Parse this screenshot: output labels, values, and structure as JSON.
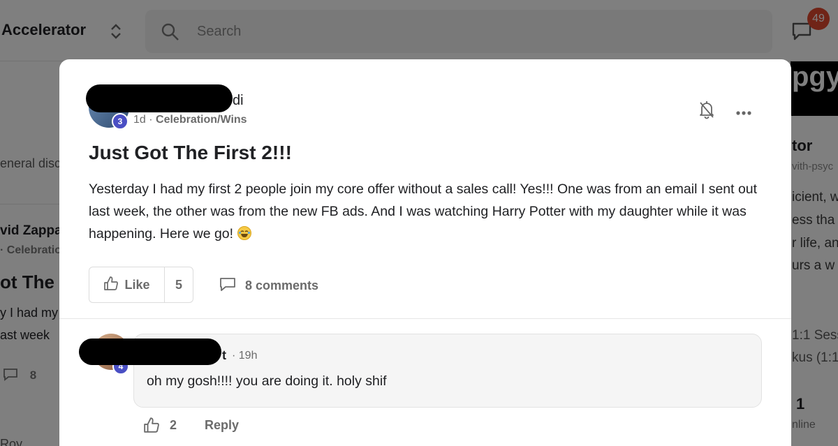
{
  "background": {
    "group_name": "Accelerator",
    "search_placeholder": "Search",
    "notification_count": "49",
    "logo_fragment": "pgy",
    "left_column": {
      "category_fragment": "eneral disc",
      "author_fragment": "vid Zappa",
      "meta_fragment": "· Celebratio",
      "title_fragment": "ot The F",
      "body_line1": "y I had my",
      "body_line2": "ast week",
      "comment_count_fragment": "8",
      "bottom_fragment": "Roy"
    },
    "right_column": {
      "title_fragment": "tor",
      "subtitle_fragment": "vith-psyc",
      "line1": "icient, w",
      "line2": "ess tha",
      "line3": "r life, an",
      "line4": "urs a w",
      "line5": "1:1 Sess",
      "line6": "kus (1:1",
      "online_count": "1",
      "online_label": "nline"
    }
  },
  "post": {
    "author_suffix": "di",
    "level": "3",
    "time_ago": "1d",
    "separator": "·",
    "category": "Celebration/Wins",
    "title": "Just Got The First 2!!!",
    "body": "Yesterday I had my first 2 people join my core offer without a sales call! Yes!!! One was from an email I sent out last week, the other was from the new FB ads. And I was watching Harry Potter with my daughter while it was happening. Here we go!",
    "emoji": "joy-emoji",
    "like_label": "Like",
    "like_count": "5",
    "comments_label": "8 comments"
  },
  "comment": {
    "author_suffix": "t",
    "level": "4",
    "time": "· 19h",
    "text": "oh my gosh!!!! you are doing it. holy shif",
    "like_count": "2",
    "reply_label": "Reply"
  }
}
